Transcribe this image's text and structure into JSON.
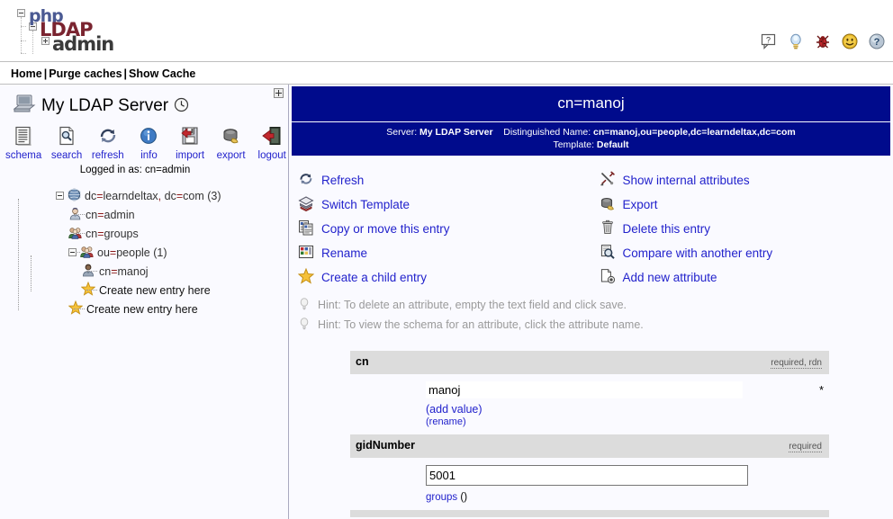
{
  "logo": {
    "part1": "php",
    "part2": "LDAP",
    "part3": "admin"
  },
  "topbar": {
    "icons": [
      {
        "name": "help-balloon-icon",
        "title": "?"
      },
      {
        "name": "lightbulb-icon",
        "title": "hint"
      },
      {
        "name": "bug-icon",
        "title": "bug"
      },
      {
        "name": "smiley-icon",
        "title": "smiley"
      },
      {
        "name": "question-sphere-icon",
        "title": "?"
      }
    ]
  },
  "nav": {
    "home": "Home",
    "purge": "Purge caches",
    "show_cache": "Show Cache",
    "separator": "|"
  },
  "sidebar": {
    "server_name": "My LDAP Server",
    "clock_icon": "clock-icon",
    "computer_icon": "computer-icon",
    "collapse_label": "+",
    "tools": [
      {
        "label": "schema",
        "icon": "schema-icon"
      },
      {
        "label": "search",
        "icon": "search-icon"
      },
      {
        "label": "refresh",
        "icon": "refresh-icon"
      },
      {
        "label": "info",
        "icon": "info-icon"
      },
      {
        "label": "import",
        "icon": "import-icon"
      },
      {
        "label": "export",
        "icon": "export-icon"
      },
      {
        "label": "logout",
        "icon": "logout-icon"
      }
    ],
    "logged_in_prefix": "Logged in as: ",
    "logged_in_user": "cn=admin",
    "tree": {
      "root": {
        "label_pre": "dc",
        "label_eq": "=",
        "label_post": "learndeltax",
        "label_sep": ",",
        "label_pre2": "dc",
        "label_post2": "com",
        "count": "(3)",
        "full": "dc=learndeltax, dc=com (3)"
      },
      "children": [
        {
          "label": "cn=admin",
          "icon": "user-icon",
          "indent": 1
        },
        {
          "label": "cn=groups",
          "icon": "group-icon",
          "indent": 1
        },
        {
          "label": "ou=people",
          "count": "(1)",
          "icon": "group-icon",
          "indent": 1,
          "expander": "minus"
        },
        {
          "label": "cn=manoj",
          "icon": "person-icon",
          "indent": 2
        },
        {
          "label": "Create new entry here",
          "icon": "star-icon",
          "indent": 2
        },
        {
          "label": "Create new entry here",
          "icon": "star-icon",
          "indent": 1
        }
      ]
    }
  },
  "entry": {
    "title": "cn=manoj",
    "server_label": "Server:",
    "server_value": "My LDAP Server",
    "dn_label": "Distinguished Name:",
    "dn_value": "cn=manoj,ou=people,dc=learndeltax,dc=com",
    "template_label": "Template:",
    "template_value": "Default"
  },
  "actions": {
    "left": [
      {
        "label": "Refresh",
        "icon": "refresh-icon"
      },
      {
        "label": "Switch Template",
        "icon": "template-icon"
      },
      {
        "label": "Copy or move this entry",
        "icon": "copy-icon"
      },
      {
        "label": "Rename",
        "icon": "rename-icon"
      },
      {
        "label": "Create a child entry",
        "icon": "star-icon"
      }
    ],
    "right": [
      {
        "label": "Show internal attributes",
        "icon": "tools-icon"
      },
      {
        "label": "Export",
        "icon": "export-icon"
      },
      {
        "label": "Delete this entry",
        "icon": "trash-icon"
      },
      {
        "label": "Compare with another entry",
        "icon": "compare-icon"
      },
      {
        "label": "Add new attribute",
        "icon": "add-attribute-icon"
      }
    ]
  },
  "hints": [
    {
      "text": "Hint: To delete an attribute, empty the text field and click save.",
      "icon": "lightbulb-icon"
    },
    {
      "text": "Hint: To view the schema for an attribute, click the attribute name.",
      "icon": "lightbulb-icon"
    }
  ],
  "attributes": [
    {
      "name": "cn",
      "flags": "required, rdn",
      "value": "manoj",
      "required_star": "*",
      "links": [
        {
          "text": "(add value)",
          "kind": "add"
        },
        {
          "text": "(rename)",
          "kind": "rename"
        }
      ]
    },
    {
      "name": "gidNumber",
      "flags": "required",
      "value": "5001",
      "required_star": "",
      "links": [
        {
          "text": "groups",
          "suffix": " ()",
          "kind": "groups"
        }
      ]
    }
  ],
  "colors": {
    "header_blue": "#000b8c",
    "link_blue": "#2222cc",
    "attr_header_gray": "#dcdcdc",
    "page_bg": "#fafaff",
    "eq_red": "#8b1a1a"
  }
}
